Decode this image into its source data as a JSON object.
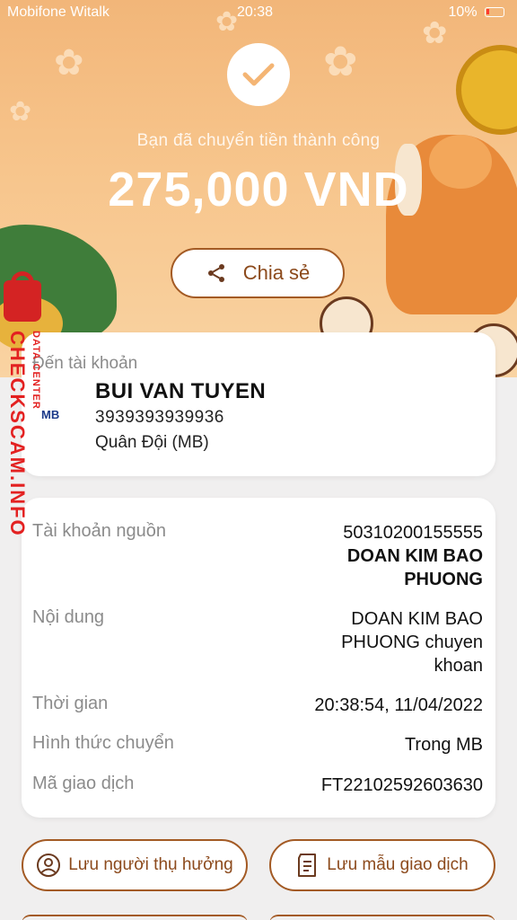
{
  "status_bar": {
    "carrier": "Mobifone Witalk",
    "time": "20:38",
    "battery": "10%"
  },
  "hero": {
    "message": "Bạn đã chuyển tiền thành công",
    "amount": "275,000 VND",
    "share_label": "Chia sẻ"
  },
  "recipient": {
    "label": "Đến tài khoản",
    "bank_logo": "MB",
    "name": "BUI VAN TUYEN",
    "account_number": "3939393939936",
    "bank_name": "Quân Đội (MB)"
  },
  "details": {
    "source_label": "Tài khoản nguồn",
    "source_account": "50310200155555",
    "source_name_line1": "DOAN KIM BAO",
    "source_name_line2": "PHUONG",
    "content_label": "Nội dung",
    "content_line1": "DOAN KIM BAO",
    "content_line2": "PHUONG chuyen",
    "content_line3": "khoan",
    "time_label": "Thời gian",
    "time_value": "20:38:54, 11/04/2022",
    "method_label": "Hình thức chuyển",
    "method_value": "Trong MB",
    "ref_label": "Mã giao dịch",
    "ref_value": "FT22102592603630"
  },
  "actions": {
    "save_recipient": "Lưu người thụ hưởng",
    "save_template": "Lưu mẫu giao dịch"
  },
  "watermark": {
    "main": "CHECKSCAM.INFO",
    "sub": "DATA CENTER"
  },
  "colors": {
    "accent": "#a35a24",
    "hero_top": "#f2b679",
    "watermark": "#e32121"
  }
}
